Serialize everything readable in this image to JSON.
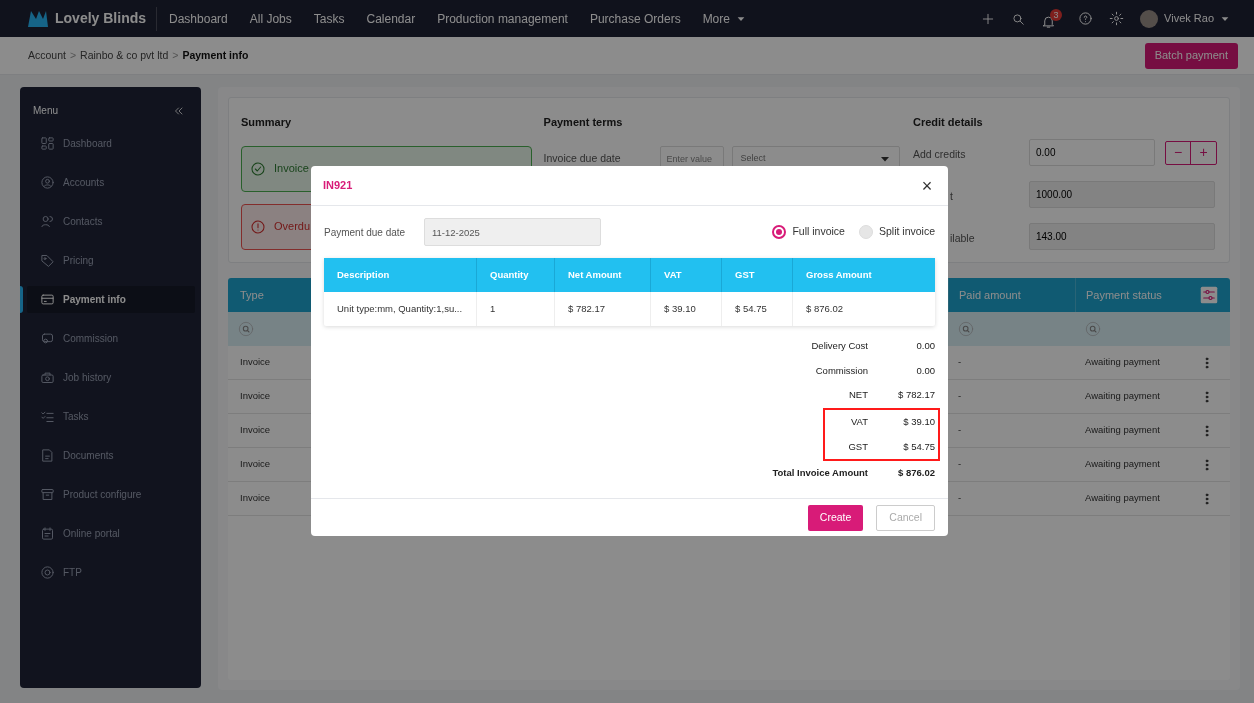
{
  "nav": {
    "brand": "Lovely Blinds",
    "links": [
      "Dashboard",
      "All Jobs",
      "Tasks",
      "Calendar",
      "Production management",
      "Purchase Orders"
    ],
    "more": "More",
    "notification_count": "3",
    "user": "Vivek Rao"
  },
  "breadcrumb": {
    "items": [
      "Account",
      "Rainbo & co pvt ltd"
    ],
    "separators": [
      ">",
      ">"
    ],
    "current": "Payment info"
  },
  "batch_button": "Batch payment",
  "sidebar": {
    "title": "Menu",
    "items": [
      {
        "label": "Dashboard",
        "selected": false
      },
      {
        "label": "Accounts",
        "selected": false
      },
      {
        "label": "Contacts",
        "selected": false
      },
      {
        "label": "Pricing",
        "selected": false
      },
      {
        "label": "Payment info",
        "selected": true
      },
      {
        "label": "Commission",
        "selected": false
      },
      {
        "label": "Job history",
        "selected": false
      },
      {
        "label": "Tasks",
        "selected": false
      },
      {
        "label": "Documents",
        "selected": false
      },
      {
        "label": "Product configure",
        "selected": false
      },
      {
        "label": "Online portal",
        "selected": false
      },
      {
        "label": "FTP",
        "selected": false
      }
    ]
  },
  "summary": {
    "title": "Summary",
    "cards": [
      {
        "kind": "success",
        "text": "Invoice"
      },
      {
        "kind": "error",
        "text": "Overdu"
      }
    ]
  },
  "payment_terms": {
    "title": "Payment terms",
    "label": "Invoice due date",
    "value_placeholder": "Enter value",
    "select_placeholder": "Select"
  },
  "credit_details": {
    "title": "Credit details",
    "rows": [
      {
        "kind": "stepper",
        "label": "Add credits",
        "value": "0.00",
        "minus": "−",
        "plus": "+"
      },
      {
        "kind": "readonly",
        "label": "t",
        "value": "1000.00"
      },
      {
        "kind": "readonly",
        "label": "ilable",
        "value": "143.00"
      }
    ]
  },
  "table": {
    "columns": [
      "Type",
      "Paid amount",
      "Payment status"
    ],
    "rows": [
      {
        "type": "Invoice",
        "paid": "-",
        "status": "Awaiting payment"
      },
      {
        "type": "Invoice",
        "paid": "-",
        "status": "Awaiting payment"
      },
      {
        "type": "Invoice",
        "paid": "-",
        "status": "Awaiting payment"
      },
      {
        "type": "Invoice",
        "paid": "-",
        "status": "Awaiting payment"
      },
      {
        "type": "Invoice",
        "paid": "-",
        "status": "Awaiting payment"
      }
    ]
  },
  "modal": {
    "title": "IN921",
    "close": "×",
    "due_label": "Payment due date",
    "due_value": "11-12-2025",
    "options": [
      {
        "label": "Full invoice",
        "selected": true
      },
      {
        "label": "Split invoice",
        "selected": false
      }
    ],
    "columns": [
      "Description",
      "Quantity",
      "Net Amount",
      "VAT",
      "GST",
      "Gross Amount"
    ],
    "rows": [
      [
        "Unit type:mm, Quantity:1,su...",
        "1",
        "$ 782.17",
        "$ 39.10",
        "$ 54.75",
        "$ 876.02"
      ]
    ],
    "totals": [
      {
        "label": "Delivery Cost",
        "value": "0.00",
        "highlighted": false,
        "bold": false
      },
      {
        "label": "Commission",
        "value": "0.00",
        "highlighted": false,
        "bold": false
      },
      {
        "label": "NET",
        "value": "$ 782.17",
        "highlighted": false,
        "bold": false
      },
      {
        "label": "VAT",
        "value": "$ 39.10",
        "highlighted": true,
        "bold": false
      },
      {
        "label": "GST",
        "value": "$ 54.75",
        "highlighted": true,
        "bold": false
      },
      {
        "label": "Total Invoice Amount",
        "value": "$ 876.02",
        "highlighted": false,
        "bold": true
      }
    ],
    "buttons": {
      "create": "Create",
      "cancel": "Cancel"
    }
  }
}
